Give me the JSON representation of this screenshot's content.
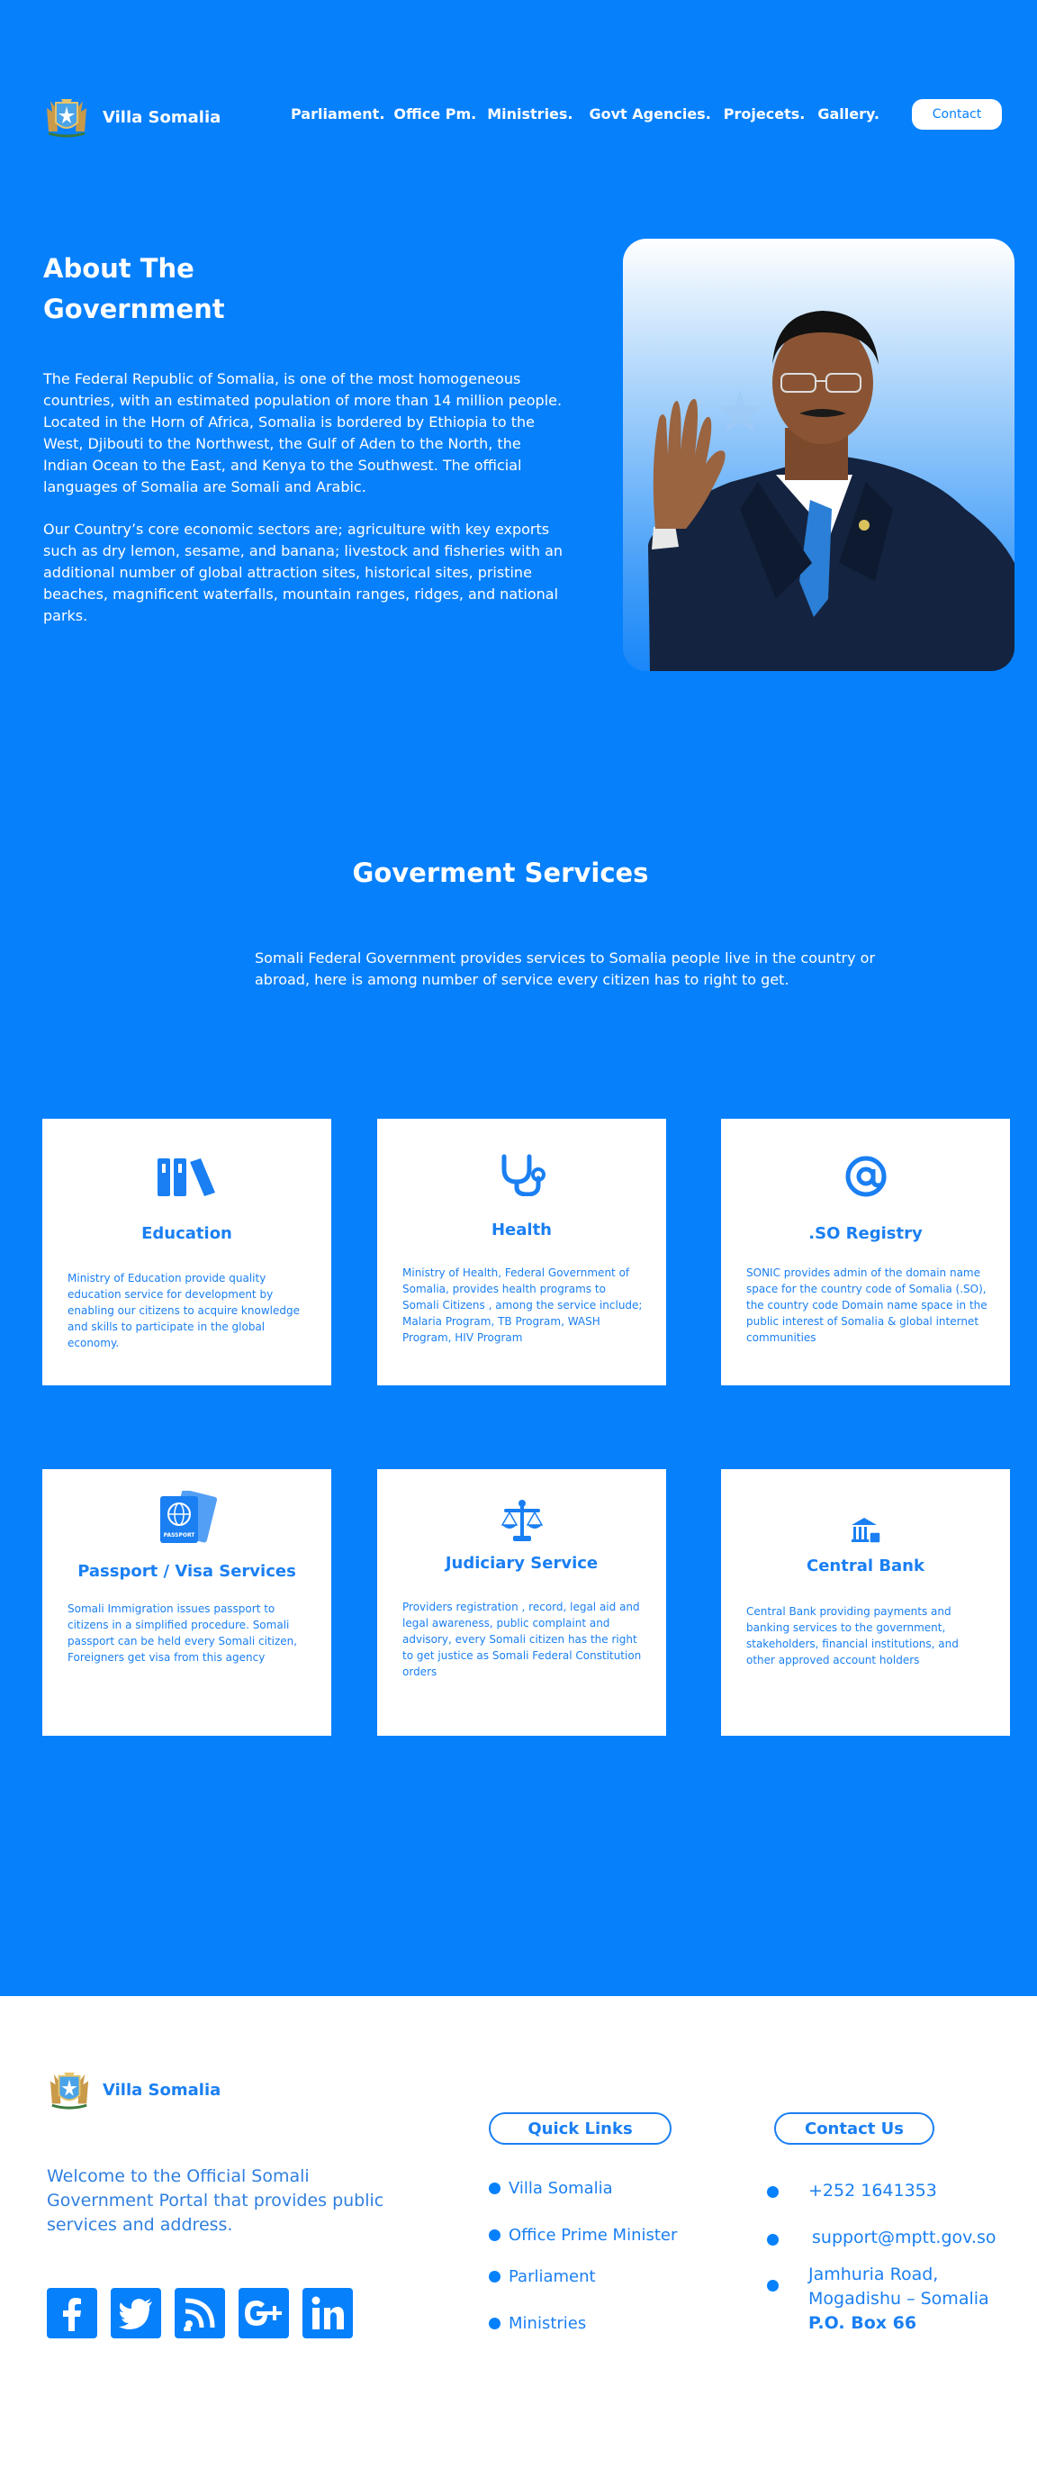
{
  "nav": {
    "brand": "Villa Somalia",
    "links": [
      "Parliament.",
      "Office Pm.",
      "Ministries.",
      "Govt Agencies.",
      "Projecets.",
      "Gallery."
    ],
    "contact": "Contact"
  },
  "about": {
    "title": "About The Government",
    "p1": "The Federal Republic of Somalia, is one of the most homogeneous countries, with an estimated population of more than 14 million people. Located in the Horn of Africa, Somalia is bordered by Ethiopia to the West, Djibouti to the Northwest, the Gulf of Aden to the North, the Indian Ocean to the East, and Kenya to the Southwest. The official languages of Somalia are Somali and Arabic.",
    "p2": "Our Country’s core economic sectors are; agriculture with key exports such as dry lemon, sesame, and banana; livestock and fisheries with an additional number of global attraction sites, historical sites, pristine beaches, magnificent waterfalls, mountain ranges, ridges, and national parks."
  },
  "services": {
    "title": "Goverment Services",
    "subtitle": "Somali Federal Government provides services to Somalia people live in the country or abroad, here is among number of service every citizen has to right to get.",
    "cards": [
      {
        "title": "Education",
        "icon": "books-icon",
        "text": "Ministry of Education provide quality education service for development by enabling our citizens to acquire knowledge and skills to participate in the global economy."
      },
      {
        "title": "Health",
        "icon": "stethoscope-icon",
        "text": "Ministry of Health, Federal Government of Somalia, provides health programs to Somali Citizens , among the service include; Malaria Program, TB Program, WASH Program, HIV Program"
      },
      {
        "title": ".SO Registry",
        "icon": "at-icon",
        "text": "SONIC provides admin of the domain name space for the country code of Somalia (.SO), the country code Domain name space in the public interest of Somalia & global internet communities"
      },
      {
        "title": "Passport / Visa Services",
        "icon": "passport-icon",
        "icon_text": "PASSPORT",
        "text": "Somali Immigration issues passport to citizens in a simplified procedure. Somali passport can be held every Somali citizen, Foreigners get visa from this agency"
      },
      {
        "title": "Judiciary Service",
        "icon": "scales-icon",
        "text": "Providers registration , record, legal aid and legal awareness, public complaint and advisory, every Somali citizen has the right to get justice as Somali Federal Constitution orders"
      },
      {
        "title": "Central Bank",
        "icon": "bank-icon",
        "text": "Central Bank providing payments and banking services to the government, stakeholders, financial institutions, and other approved account holders"
      }
    ]
  },
  "footer": {
    "brand": "Villa Somalia",
    "welcome": "Welcome to the Official Somali Government Portal that provides public services and address.",
    "socials": [
      "facebook-icon",
      "twitter-icon",
      "rss-icon",
      "google-plus-icon",
      "linkedin-icon"
    ],
    "quick_links_title": "Quick Links",
    "quick_links": [
      "Villa Somalia",
      "Office Prime Minister",
      "Parliament",
      "Ministries"
    ],
    "contact_title": "Contact Us",
    "phone": "+252 1641353",
    "email": "support@mptt.gov.so",
    "address_line1": "Jamhuria Road,",
    "address_line2": "Mogadishu – Somalia",
    "address_line3": "P.O. Box 66"
  },
  "colors": {
    "primary": "#0780fc",
    "text_blue": "#1a7ff2",
    "white": "#ffffff"
  }
}
